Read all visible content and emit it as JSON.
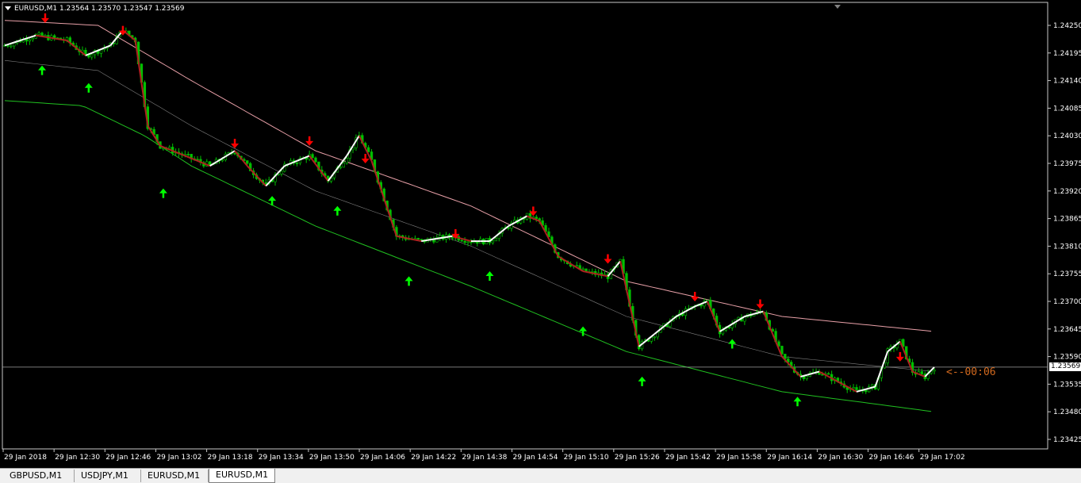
{
  "window": {
    "header": "EURUSD,M1  1.23564 1.23570 1.23547 1.23569",
    "countdown": "<--00:06"
  },
  "tabs": [
    {
      "label": "GBPUSD,M1",
      "active": false
    },
    {
      "label": "USDJPY,M1",
      "active": false
    },
    {
      "label": "EURUSD,M1",
      "active": false
    },
    {
      "label": "EURUSD,M1",
      "active": true
    }
  ],
  "colors": {
    "background": "#000000",
    "bull_candle": "#00c000",
    "bear_candle": "#ffffff",
    "upper_band": "#e8a0a8",
    "lower_band": "#20c020",
    "mid_band": "#808080",
    "trend_down": "#b02020",
    "trend_up": "#ffffff",
    "arrow_down": "#ff0000",
    "arrow_up": "#00ff00",
    "bid_line": "#a0a0a0"
  },
  "chart_data": {
    "type": "line",
    "symbol": "EURUSD",
    "timeframe": "M1",
    "ohlc_last": {
      "open": 1.23564,
      "high": 1.2357,
      "low": 1.23547,
      "close": 1.23569
    },
    "current_price": "1.23569",
    "ylim": [
      1.23405,
      1.2428
    ],
    "yticks": [
      "1.24250",
      "1.24195",
      "1.24140",
      "1.24085",
      "1.24030",
      "1.23975",
      "1.23920",
      "1.23865",
      "1.23810",
      "1.23755",
      "1.23700",
      "1.23645",
      "1.23590",
      "1.23535",
      "1.23480",
      "1.23425"
    ],
    "xticks": [
      "29 Jan 2018",
      "29 Jan 12:30",
      "29 Jan 12:46",
      "29 Jan 13:02",
      "29 Jan 13:18",
      "29 Jan 13:34",
      "29 Jan 13:50",
      "29 Jan 14:06",
      "29 Jan 14:22",
      "29 Jan 14:38",
      "29 Jan 14:54",
      "29 Jan 15:10",
      "29 Jan 15:26",
      "29 Jan 15:42",
      "29 Jan 15:58",
      "29 Jan 16:14",
      "29 Jan 16:30",
      "29 Jan 16:46",
      "29 Jan 17:02"
    ],
    "x_minutes": [
      0,
      299
    ],
    "price_path": [
      [
        0,
        1.2421
      ],
      [
        10,
        1.2423
      ],
      [
        20,
        1.2422
      ],
      [
        26,
        1.2419
      ],
      [
        34,
        1.2421
      ],
      [
        38,
        1.2424
      ],
      [
        42,
        1.2422
      ],
      [
        46,
        1.2405
      ],
      [
        50,
        1.2401
      ],
      [
        58,
        1.2399
      ],
      [
        66,
        1.2397
      ],
      [
        74,
        1.24
      ],
      [
        78,
        1.2397
      ],
      [
        84,
        1.2393
      ],
      [
        90,
        1.2397
      ],
      [
        98,
        1.2399
      ],
      [
        104,
        1.2394
      ],
      [
        110,
        1.2399
      ],
      [
        114,
        1.2403
      ],
      [
        118,
        1.2398
      ],
      [
        126,
        1.2383
      ],
      [
        134,
        1.2382
      ],
      [
        144,
        1.2383
      ],
      [
        150,
        1.2382
      ],
      [
        156,
        1.2382
      ],
      [
        162,
        1.2385
      ],
      [
        168,
        1.2387
      ],
      [
        172,
        1.2386
      ],
      [
        178,
        1.2379
      ],
      [
        186,
        1.2376
      ],
      [
        194,
        1.2375
      ],
      [
        198,
        1.2378
      ],
      [
        204,
        1.2361
      ],
      [
        210,
        1.2364
      ],
      [
        216,
        1.2367
      ],
      [
        222,
        1.2369
      ],
      [
        226,
        1.237
      ],
      [
        230,
        1.2364
      ],
      [
        238,
        1.2367
      ],
      [
        244,
        1.2368
      ],
      [
        250,
        1.2359
      ],
      [
        256,
        1.2355
      ],
      [
        262,
        1.2356
      ],
      [
        268,
        1.2354
      ],
      [
        274,
        1.2352
      ],
      [
        280,
        1.2353
      ],
      [
        284,
        1.236
      ],
      [
        288,
        1.2362
      ],
      [
        292,
        1.2356
      ],
      [
        296,
        1.2355
      ],
      [
        299,
        1.23569
      ]
    ],
    "series": [
      {
        "name": "upper",
        "values": [
          [
            0,
            1.2426
          ],
          [
            30,
            1.2425
          ],
          [
            60,
            1.2414
          ],
          [
            100,
            1.24
          ],
          [
            150,
            1.2389
          ],
          [
            200,
            1.2374
          ],
          [
            250,
            1.2367
          ],
          [
            299,
            1.2364
          ]
        ]
      },
      {
        "name": "middle",
        "values": [
          [
            0,
            1.2418
          ],
          [
            30,
            1.2416
          ],
          [
            60,
            1.2405
          ],
          [
            100,
            1.2392
          ],
          [
            150,
            1.2381
          ],
          [
            200,
            1.2367
          ],
          [
            250,
            1.2359
          ],
          [
            299,
            1.2356
          ]
        ]
      },
      {
        "name": "lower",
        "values": [
          [
            0,
            1.241
          ],
          [
            25,
            1.2409
          ],
          [
            45,
            1.2403
          ],
          [
            60,
            1.2397
          ],
          [
            100,
            1.2385
          ],
          [
            150,
            1.2373
          ],
          [
            200,
            1.236
          ],
          [
            250,
            1.2352
          ],
          [
            299,
            1.2348
          ]
        ]
      }
    ],
    "signals_down": [
      [
        13,
        1.24255
      ],
      [
        38,
        1.2423
      ],
      [
        74,
        1.24005
      ],
      [
        98,
        1.2401
      ],
      [
        116,
        1.23975
      ],
      [
        145,
        1.23825
      ],
      [
        170,
        1.2387
      ],
      [
        194,
        1.23775
      ],
      [
        222,
        1.237
      ],
      [
        243,
        1.23685
      ],
      [
        288,
        1.2358
      ]
    ],
    "signals_up": [
      [
        12,
        1.2417
      ],
      [
        27,
        1.24135
      ],
      [
        51,
        1.23925
      ],
      [
        86,
        1.2391
      ],
      [
        107,
        1.2389
      ],
      [
        130,
        1.2375
      ],
      [
        156,
        1.2376
      ],
      [
        186,
        1.2365
      ],
      [
        205,
        1.2355
      ],
      [
        234,
        1.23625
      ],
      [
        255,
        1.2351
      ]
    ]
  }
}
